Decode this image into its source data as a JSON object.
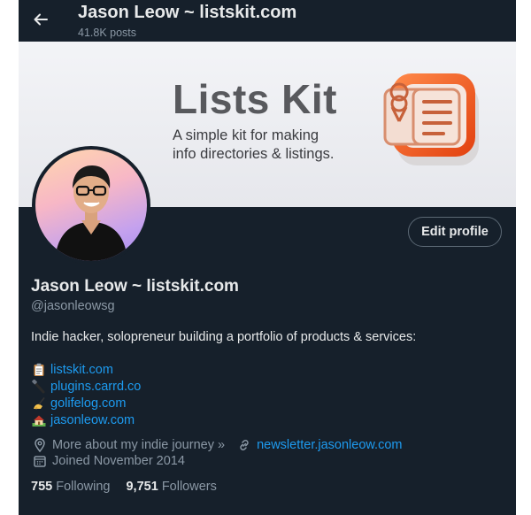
{
  "header": {
    "title": "Jason Leow ~ listskit.com",
    "posts": "41.8K posts"
  },
  "banner": {
    "title": "Lists Kit",
    "line1": "A simple kit for making",
    "line2": "info directories & listings."
  },
  "actions": {
    "edit_profile": "Edit profile"
  },
  "profile": {
    "name": "Jason Leow ~ listskit.com",
    "handle": "@jasonleowsg",
    "bio": "Indie hacker, solopreneur building a portfolio of products & services:",
    "links": [
      {
        "icon": "clipboard-icon",
        "text": "listskit.com"
      },
      {
        "icon": "usb-cable-icon",
        "text": "plugins.carrd.co"
      },
      {
        "icon": "writing-hand-icon",
        "text": "golifelog.com"
      },
      {
        "icon": "house-icon",
        "text": "jasonleow.com"
      }
    ],
    "about_link": "More about my indie journey »",
    "newsletter": "newsletter.jasonleow.com",
    "joined": "Joined November 2014"
  },
  "stats": {
    "following_count": "755",
    "following_label": "Following",
    "followers_count": "9,751",
    "followers_label": "Followers"
  },
  "colors": {
    "background": "#16202b",
    "text": "#e7e9ea",
    "muted": "#8b98a5",
    "link": "#1d9bf0",
    "banner_accent": "#f05a1e"
  }
}
